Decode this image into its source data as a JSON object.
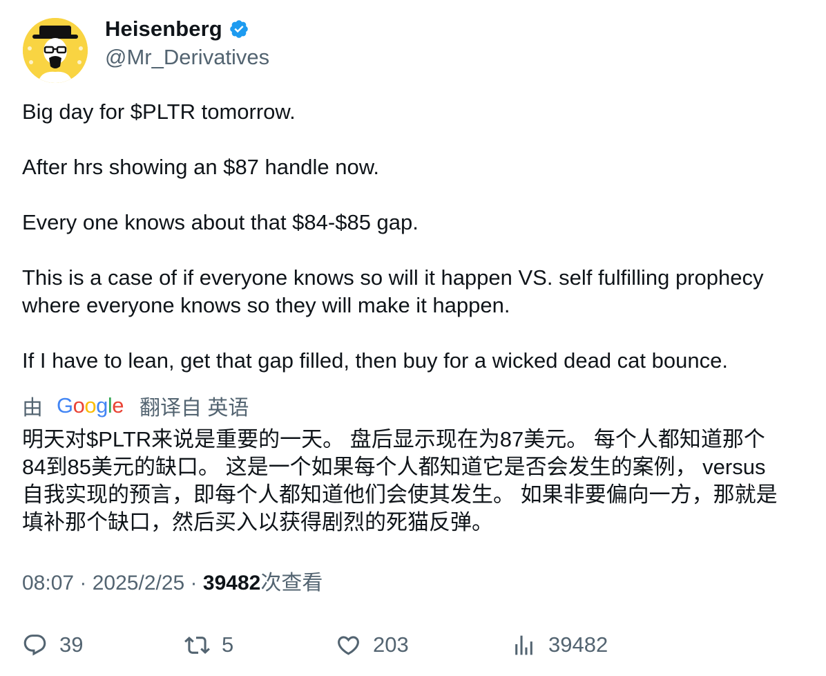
{
  "author": {
    "display_name": "Heisenberg",
    "handle": "@Mr_Derivatives",
    "avatar_icon": "heisenberg-avatar",
    "verified_icon": "verified-badge-icon",
    "verified_color": "#1d9bf0"
  },
  "tweet": {
    "lines": [
      "Big day for $PLTR tomorrow.",
      "After hrs showing an $87 handle now.",
      "Every one knows about that $84-$85 gap.",
      "This is a case of if everyone knows so will it happen VS. self fulfilling prophecy",
      "where everyone knows so they will make it happen.",
      "If I have to lean, get that gap filled, then buy for a wicked dead cat bounce."
    ]
  },
  "translation_bar": {
    "by_label": "由",
    "provider_logo": "Google",
    "from_label": "翻译自 英语"
  },
  "translation": {
    "lines": [
      "明天对$PLTR来说是重要的一天。 盘后显示现在为87美元。 每个人都知道那个",
      "84到85美元的缺口。 这是一个如果每个人都知道它是否会发生的案例， versus",
      "自我实现的预言，即每个人都知道他们会使其发生。 如果非要偏向一方，那就是",
      "填补那个缺口，然后买入以获得剧烈的死猫反弹。"
    ]
  },
  "meta": {
    "time": "08:07",
    "separator": " · ",
    "date": "2025/2/25",
    "views_count": "39482",
    "views_label": "次查看"
  },
  "actions": {
    "replies": "39",
    "retweets": "5",
    "likes": "203",
    "views": "39482",
    "icon_color": "#536471"
  },
  "colors": {
    "text_primary": "#0f1419",
    "text_secondary": "#536471",
    "avatar_bg": "#f9d442"
  }
}
